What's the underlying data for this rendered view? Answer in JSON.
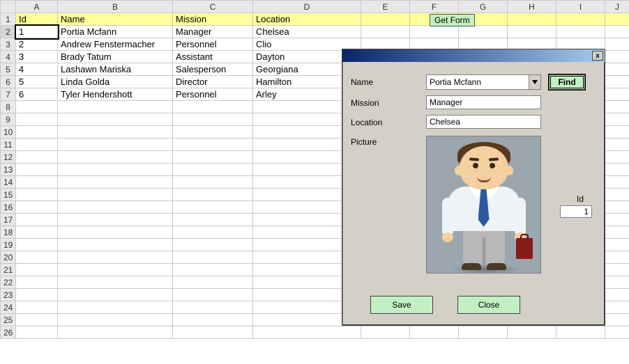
{
  "columns": [
    "A",
    "B",
    "C",
    "D",
    "E",
    "F",
    "G",
    "H",
    "I",
    "J"
  ],
  "header_row": {
    "id": "Id",
    "name": "Name",
    "mission": "Mission",
    "location": "Location"
  },
  "rows": [
    {
      "id": "1",
      "name": "Portia Mcfann",
      "mission": "Manager",
      "location": "Chelsea"
    },
    {
      "id": "2",
      "name": "Andrew Fenstermacher",
      "mission": "Personnel",
      "location": "Clio"
    },
    {
      "id": "3",
      "name": "Brady Tatum",
      "mission": "Assistant",
      "location": "Dayton"
    },
    {
      "id": "4",
      "name": "Lashawn Mariska",
      "mission": "Salesperson",
      "location": "Georgiana"
    },
    {
      "id": "5",
      "name": "Linda Golda",
      "mission": "Director",
      "location": "Hamilton"
    },
    {
      "id": "6",
      "name": "Tyler Hendershott",
      "mission": "Personnel",
      "location": "Arley"
    }
  ],
  "row_count_visible": 26,
  "get_form_button": "Get Form",
  "form": {
    "labels": {
      "name": "Name",
      "mission": "Mission",
      "location": "Location",
      "picture": "Picture",
      "id": "Id"
    },
    "name_value": "Portia Mcfann",
    "mission_value": "Manager",
    "location_value": "Chelsea",
    "id_value": "1",
    "buttons": {
      "find": "Find",
      "save": "Save",
      "close": "Close"
    },
    "close_x": "x"
  }
}
